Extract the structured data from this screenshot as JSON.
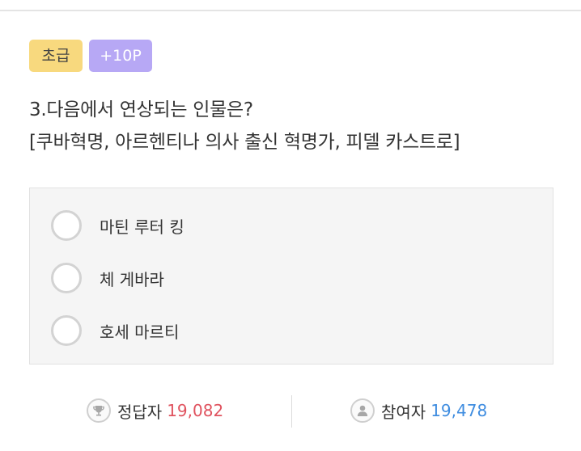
{
  "badges": {
    "level": "초급",
    "points": "+10P"
  },
  "question": {
    "line1": "3.다음에서 연상되는 인물은?",
    "line2": "[쿠바혁명, 아르헨티나 의사 출신 혁명가, 피델 카스트로]"
  },
  "options": [
    {
      "label": "마틴 루터 킹"
    },
    {
      "label": "체 게바라"
    },
    {
      "label": "호세 마르티"
    }
  ],
  "stats": {
    "correct_label": "정답자",
    "correct_count": "19,082",
    "participants_label": "참여자",
    "participants_count": "19,478"
  },
  "colors": {
    "level_badge": "#f8d97e",
    "points_badge": "#b7a8f5",
    "correct_count": "#e0535f",
    "participants_count": "#3f8de0"
  },
  "icons": {
    "correct": "trophy-icon",
    "participants": "person-icon"
  }
}
